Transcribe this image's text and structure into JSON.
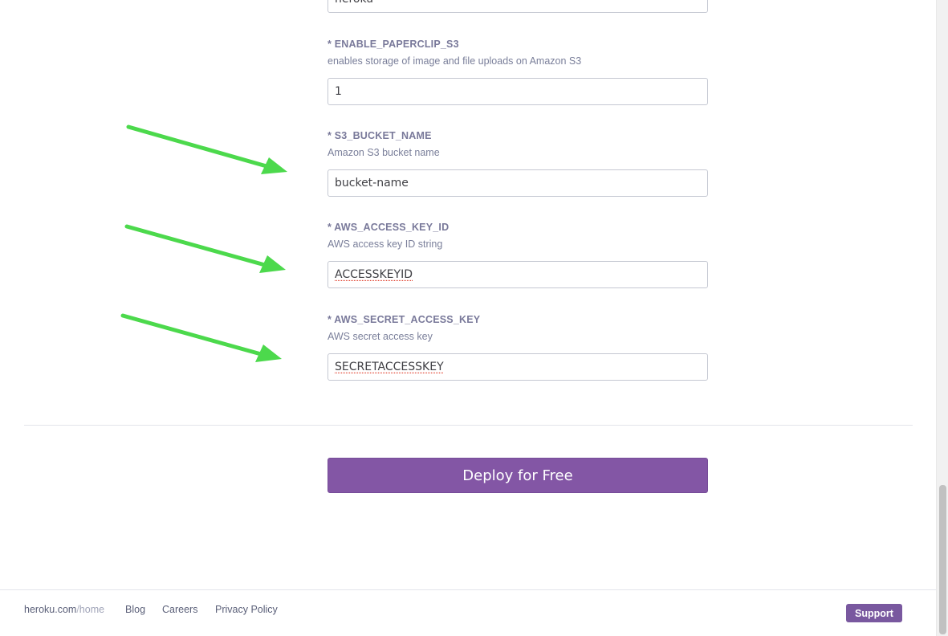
{
  "form": {
    "top_input_value": "heroku",
    "fields": [
      {
        "label": "* ENABLE_PAPERCLIP_S3",
        "description": "enables storage of image and file uploads on Amazon S3",
        "value": "1"
      },
      {
        "label": "* S3_BUCKET_NAME",
        "description": "Amazon S3 bucket name",
        "value": "bucket-name"
      },
      {
        "label": "* AWS_ACCESS_KEY_ID",
        "description": "AWS access key ID string",
        "value": "ACCESSKEYID"
      },
      {
        "label": "* AWS_SECRET_ACCESS_KEY",
        "description": "AWS secret access key",
        "value": "SECRETACCESSKEY"
      }
    ],
    "deploy_label": "Deploy for Free"
  },
  "footer": {
    "brand": "heroku.com",
    "brand_slash": "/",
    "brand_home": "home",
    "links": [
      "Blog",
      "Careers",
      "Privacy Policy"
    ],
    "support_label": "Support"
  },
  "annotations": {
    "arrow_color": "#4cd94c",
    "arrow_icon": "arrow-right-down"
  },
  "colors": {
    "accent": "#8356a5",
    "label": "#79799a"
  }
}
